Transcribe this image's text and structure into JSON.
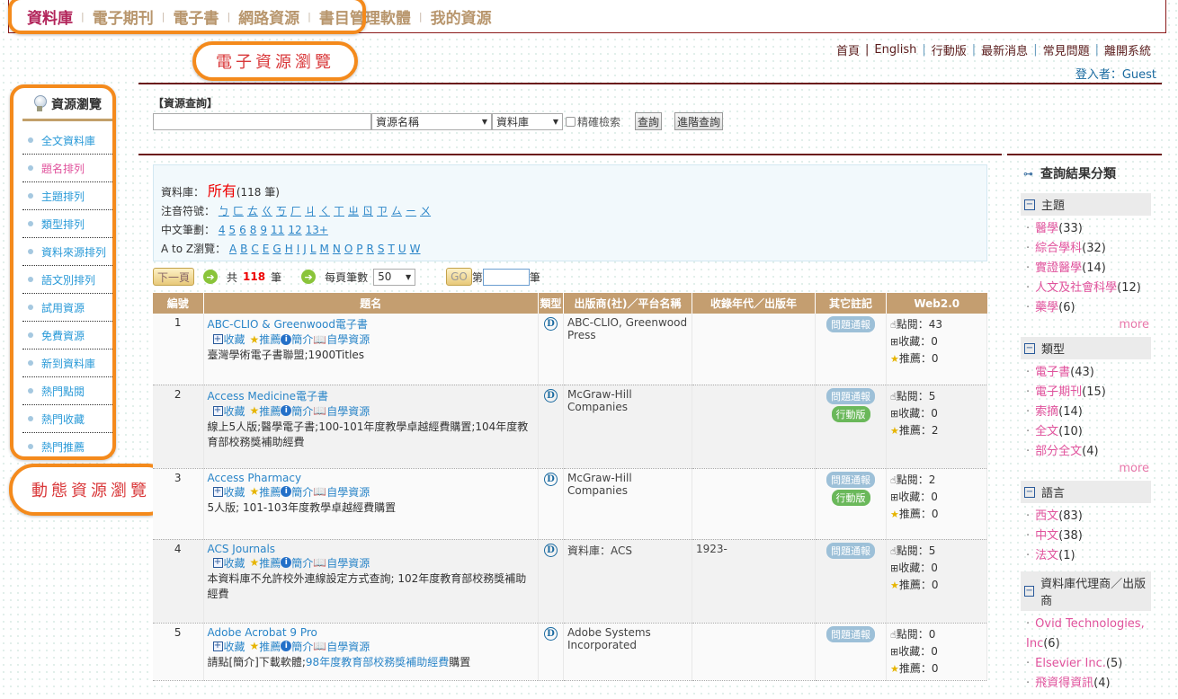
{
  "top_nav": {
    "items": [
      {
        "label": "資料庫",
        "active": true
      },
      {
        "label": "電子期刊",
        "active": false
      },
      {
        "label": "電子書",
        "active": false
      },
      {
        "label": "網路資源",
        "active": false
      },
      {
        "label": "書目管理軟體",
        "active": false
      },
      {
        "label": "我的資源",
        "active": false
      }
    ],
    "separator": "|"
  },
  "callouts": {
    "top": "電子資源瀏覽",
    "left": "動態資源瀏覽"
  },
  "utility_links": [
    "首頁",
    "English",
    "行動版",
    "最新消息",
    "常見問題",
    "離開系統"
  ],
  "login": "登入者：Guest",
  "sidebar": {
    "title": "資源瀏覽",
    "items": [
      {
        "label": "全文資料庫",
        "active": false
      },
      {
        "label": "題名排列",
        "active": true
      },
      {
        "label": "主題排列",
        "active": false
      },
      {
        "label": "類型排列",
        "active": false
      },
      {
        "label": "資料來源排列",
        "active": false
      },
      {
        "label": "語文別排列",
        "active": false
      },
      {
        "label": "試用資源",
        "active": false
      },
      {
        "label": "免費資源",
        "active": false
      },
      {
        "label": "新到資料庫",
        "active": false
      },
      {
        "label": "熱門點閱",
        "active": false
      },
      {
        "label": "熱門收藏",
        "active": false
      },
      {
        "label": "熱門推薦",
        "active": false
      }
    ]
  },
  "search": {
    "label": "【資源查詢】",
    "query_value": "",
    "field_select": "資源名稱",
    "scope_select": "資料庫",
    "exact_label": "精確檢索",
    "exact_checked": false,
    "search_button": "查詢",
    "advanced_button": "進階查詢"
  },
  "browse": {
    "db_label": "資料庫：",
    "db_value": "所有",
    "db_count": "(118 筆)",
    "zhuyin_label": "注音符號：",
    "zhuyin": [
      "ㄅ",
      "ㄈ",
      "ㄊ",
      "ㄍ",
      "ㄎ",
      "ㄏ",
      "ㄐ",
      "ㄑ",
      "ㄒ",
      "ㄓ",
      "ㄖ",
      "ㄗ",
      "ㄙ",
      "ㄧ",
      "ㄨ"
    ],
    "strokes_label": "中文筆劃：",
    "strokes": [
      "4",
      "5",
      "6",
      "8",
      "9",
      "11",
      "12",
      "13+"
    ],
    "az_label": "A to Z瀏覽：",
    "az": [
      "A",
      "B",
      "C",
      "E",
      "G",
      "H",
      "I",
      "J",
      "L",
      "M",
      "N",
      "O",
      "P",
      "R",
      "S",
      "T",
      "U",
      "W"
    ]
  },
  "pager": {
    "next_button": "下一頁",
    "total_prefix": "共",
    "total": "118",
    "total_suffix": "筆",
    "per_page_label": "每頁筆數",
    "per_page": "50",
    "go_button": "GO",
    "page_prefix": "第",
    "page_value": "",
    "page_suffix": "筆"
  },
  "table": {
    "headers": [
      "編號",
      "題名",
      "類型",
      "出版商(社)／平台名稱",
      "收錄年代／出版年",
      "其它註記",
      "Web2.0"
    ],
    "action_labels": {
      "collect": "收藏",
      "recommend": "推薦",
      "intro": "簡介",
      "self_study": "自學資源"
    },
    "stat_labels": {
      "views": "點閱：",
      "collects": "收藏：",
      "recommends": "推薦："
    },
    "type_icon": "D",
    "rows": [
      {
        "num": "1",
        "title": "ABC-CLIO & Greenwood電子書",
        "desc": "臺灣學術電子書聯盟;1900Titles",
        "desc_link": "",
        "desc_tail": "",
        "publisher": "ABC-CLIO, Greenwood Press",
        "year": "",
        "badges": [
          "問題通報"
        ],
        "views": "43",
        "collects": "0",
        "recommends": "0"
      },
      {
        "num": "2",
        "title": "Access Medicine電子書",
        "desc": "線上5人版;醫學電子書;100-101年度教學卓越經費購置;104年度教育部校務獎補助經費",
        "desc_link": "",
        "desc_tail": "",
        "publisher": "McGraw-Hill Companies",
        "year": "",
        "badges": [
          "問題通報",
          "行動版"
        ],
        "views": "5",
        "collects": "0",
        "recommends": "2"
      },
      {
        "num": "3",
        "title": "Access Pharmacy",
        "desc": "5人版; 101-103年度教學卓越經費購置",
        "desc_link": "",
        "desc_tail": "",
        "publisher": "McGraw-Hill Companies",
        "year": "",
        "badges": [
          "問題通報",
          "行動版"
        ],
        "views": "2",
        "collects": "0",
        "recommends": "0"
      },
      {
        "num": "4",
        "title": "ACS Journals",
        "desc": "本資料庫不允許校外連線設定方式查詢; 102年度教育部校務獎補助經費",
        "desc_link": "",
        "desc_tail": "",
        "publisher": "資料庫：ACS",
        "year": "1923-",
        "badges": [
          "問題通報"
        ],
        "views": "5",
        "collects": "0",
        "recommends": "0"
      },
      {
        "num": "5",
        "title": "Adobe Acrobat 9 Pro",
        "desc": "請點[簡介]下載軟體;",
        "desc_link": "98年度教育部校務獎補助經費",
        "desc_tail": "購置",
        "publisher": "Adobe Systems Incorporated",
        "year": "",
        "badges": [
          "問題通報"
        ],
        "views": "0",
        "collects": "0",
        "recommends": "0"
      }
    ]
  },
  "facets": {
    "title": "查詢結果分類",
    "more_label": "more",
    "groups": [
      {
        "name": "主題",
        "items": [
          {
            "label": "醫學",
            "count": "(33)"
          },
          {
            "label": "綜合學科",
            "count": "(32)"
          },
          {
            "label": "實證醫學",
            "count": "(14)"
          },
          {
            "label": "人文及社會科學",
            "count": "(12)"
          },
          {
            "label": "藥學",
            "count": "(6)"
          }
        ],
        "has_more": true
      },
      {
        "name": "類型",
        "items": [
          {
            "label": "電子書",
            "count": "(43)"
          },
          {
            "label": "電子期刊",
            "count": "(15)"
          },
          {
            "label": "索摘",
            "count": "(14)"
          },
          {
            "label": "全文",
            "count": "(10)"
          },
          {
            "label": "部分全文",
            "count": "(4)"
          }
        ],
        "has_more": true
      },
      {
        "name": "語言",
        "items": [
          {
            "label": "西文",
            "count": "(83)"
          },
          {
            "label": "中文",
            "count": "(38)"
          },
          {
            "label": "法文",
            "count": "(1)"
          }
        ],
        "has_more": false
      },
      {
        "name": "資料庫代理商／出版商",
        "items": [
          {
            "label": "Ovid Technologies, Inc",
            "count": "(6)"
          },
          {
            "label": "Elsevier Inc.",
            "count": "(5)"
          },
          {
            "label": "飛資得資訊",
            "count": "(4)"
          }
        ],
        "has_more": false
      }
    ]
  },
  "colors": {
    "accent_orange": "#f48a1c",
    "header_tan": "#c49e70",
    "nav_active": "#b2245a",
    "nav_inactive": "#b8966d",
    "link_blue": "#2a85c8",
    "facet_pink": "#e0529c",
    "border_maroon": "#6b1a1a"
  }
}
